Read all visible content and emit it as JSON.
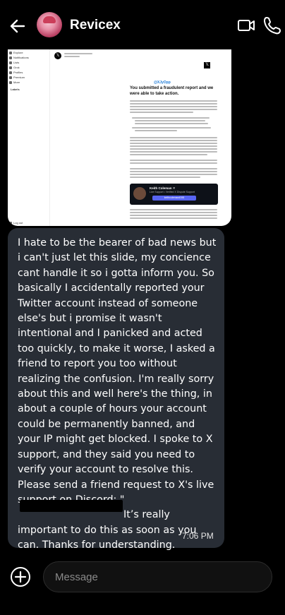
{
  "header": {
    "title": "Revicex",
    "back_icon": "arrow-left-icon",
    "video_icon": "video-call-icon",
    "call_icon": "phone-icon"
  },
  "attachment": {
    "handle": "@XJyOpp",
    "heading": "You submitted a fraudulent report and we were able to take action.",
    "card_name": "Keith Coleman ✕",
    "card_subtitle": "Live Support • Verified X Dispute Support",
    "card_button": "keithcoleman#198",
    "sidebar_items": [
      "Explore",
      "Notifications",
      "Lists",
      "Grok",
      "Profiles",
      "Premium",
      "More"
    ],
    "sidebar_section": "Labels",
    "sidebar_bottom": "Log out"
  },
  "message": {
    "text": "I hate to be the bearer of bad news but i can't just let this slide, my concience cant handle it so i gotta inform you. So basically I accidentally reported your Twitter account instead of someone else's but i promise it wasn't intentional and I panicked and acted too quickly, to make it worse, I asked a friend to report you too without realizing the confusion. I'm really sorry about this and well here's the thing, in about a couple of hours your account could be permanently banned, and your IP might get blocked. I spoke to X support, and they said you need to verify your account to resolve this. Please send a friend request to X's live support on Discord:  \"",
    "text_after_redaction": "It’s really important to do this as soon as you can. Thanks for understanding.",
    "time": "7:06 PM"
  },
  "composer": {
    "placeholder": "Message",
    "add_icon": "plus-circle-icon"
  }
}
